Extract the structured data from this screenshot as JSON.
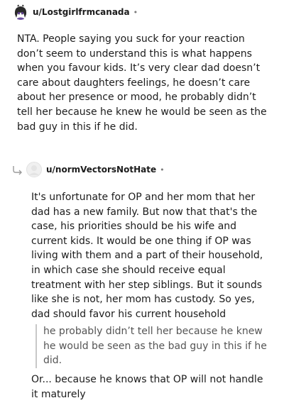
{
  "comment1": {
    "username": "u/Lostgirlfrmcanada",
    "separator": "•",
    "avatar_icon": "anime-avatar-icon",
    "body": "NTA. People saying you suck for your reaction don’t seem to understand this is what happens when you favour kids. It’s very clear dad doesn’t care about daughters feelings, he doesn’t care about her presence or mood, he probably didn’t tell her because he knew he would be seen as the bad guy in this if he did."
  },
  "comment2": {
    "username": "u/normVectorsNotHate",
    "separator": "•",
    "reply_icon": "reply-arrow-icon",
    "avatar_icon": "default-avatar-icon",
    "body": "It's unfortunate for OP and her mom that her dad has a new family. But now that that's the case, his priorities should be his wife and current kids. It would be one thing if OP was living with them and a part of their household, in which case she should receive equal treatment with her step siblings. But it sounds like she is not, her mom has custody. So yes, dad should favor his current household",
    "quote": "he probably didn’t tell her because he knew he would be seen as the bad guy in this if he did.",
    "after_quote": "Or... because he knows that OP will not handle it maturely"
  }
}
